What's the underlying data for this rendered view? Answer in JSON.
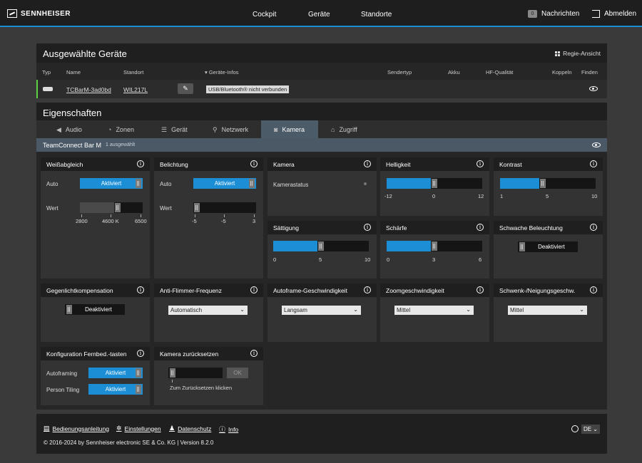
{
  "header": {
    "brand": "SENNHEISER",
    "nav": [
      "Cockpit",
      "Geräte",
      "Standorte"
    ],
    "messages_label": "Nachrichten",
    "messages_count": "0",
    "logout_label": "Abmelden"
  },
  "devices_panel": {
    "title": "Ausgewählte Geräte",
    "regie_label": "Regie-Ansicht",
    "columns": [
      "Typ",
      "Name",
      "Standort",
      "▾ Geräte-Infos",
      "Sendertyp",
      "Akku",
      "HF-Qualität",
      "Koppeln",
      "Finden"
    ],
    "row": {
      "name": "TCBarM-3ad0bd",
      "location": "WIL217L",
      "info": "USB/Bluetooth® nicht verbunden"
    }
  },
  "properties": {
    "title": "Eigenschaften",
    "tabs": [
      {
        "label": "Audio",
        "icon": "◀"
      },
      {
        "label": "Zonen",
        "icon": "◔"
      },
      {
        "label": "Gerät",
        "icon": "☰"
      },
      {
        "label": "Netzwerk",
        "icon": "⚲"
      },
      {
        "label": "Kamera",
        "icon": "◙"
      },
      {
        "label": "Zugriff",
        "icon": "⌂"
      }
    ],
    "active_tab": "Kamera",
    "device_name": "TeamConnect Bar M",
    "selected_count": "1 ausgewählt"
  },
  "cards": {
    "weissabgleich": {
      "title": "Weißabgleich",
      "auto_label": "Auto",
      "auto_value": "Aktiviert",
      "wert_label": "Wert",
      "ticks": [
        "2800",
        "4600 K",
        "6500"
      ],
      "level": 0.62
    },
    "belichtung": {
      "title": "Belichtung",
      "auto_label": "Auto",
      "auto_value": "Aktiviert",
      "wert_label": "Wert",
      "ticks": [
        "-5",
        "-5",
        "3"
      ],
      "level": 0.0
    },
    "kamera": {
      "title": "Kamera",
      "status_label": "Kamerastatus"
    },
    "helligkeit": {
      "title": "Helligkeit",
      "ticks": [
        "-12",
        "0",
        "12"
      ],
      "level": 0.5
    },
    "kontrast": {
      "title": "Kontrast",
      "ticks": [
        "1",
        "5",
        "10"
      ],
      "level": 0.44
    },
    "saettigung": {
      "title": "Sättigung",
      "ticks": [
        "0",
        "5",
        "10"
      ],
      "level": 0.5
    },
    "schaerfe": {
      "title": "Schärfe",
      "ticks": [
        "0",
        "3",
        "6"
      ],
      "level": 0.5
    },
    "schwache": {
      "title": "Schwache Beleuchtung",
      "value": "Deaktiviert"
    },
    "gegenlicht": {
      "title": "Gegenlichtkompensation",
      "value": "Deaktiviert"
    },
    "flimmer": {
      "title": "Anti-Flimmer-Frequenz",
      "value": "Automatisch"
    },
    "autoframe": {
      "title": "Autoframe-Geschwindigkeit",
      "value": "Langsam"
    },
    "zoom": {
      "title": "Zoomgeschwindigkeit",
      "value": "Mittel"
    },
    "schwenk": {
      "title": "Schwenk-/Neigungsgeschw.",
      "value": "Mittel"
    },
    "fernbed": {
      "title": "Konfiguration Fernbed.-tasten",
      "autoframing_label": "Autoframing",
      "autoframing_value": "Aktiviert",
      "tiling_label": "Person Tiling",
      "tiling_value": "Aktiviert"
    },
    "reset": {
      "title": "Kamera zurücksetzen",
      "ok_label": "OK",
      "hint": "Zum Zurücksetzen klicken"
    }
  },
  "footer": {
    "links": [
      "Bedienungsanleitung",
      "Einstellungen",
      "Datenschutz",
      "Info"
    ],
    "copyright": "© 2016-2024 by Sennheiser electronic SE & Co. KG | Version 8.2.0",
    "language": "DE"
  }
}
